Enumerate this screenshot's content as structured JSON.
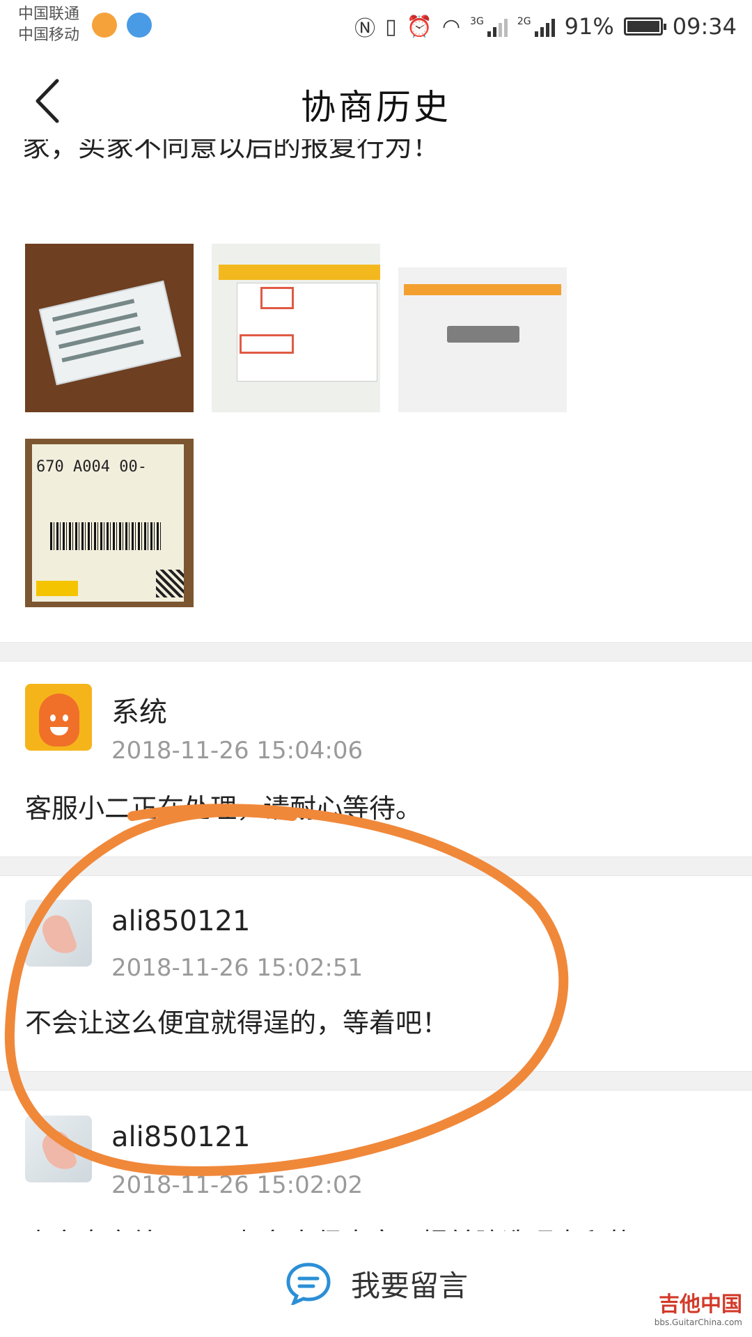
{
  "status_bar": {
    "carrier_1": "中国联通",
    "carrier_2": "中国移动",
    "net_3g": "3G",
    "net_2g": "2G",
    "battery": "91%",
    "time": "09:34"
  },
  "header": {
    "title": "协商历史"
  },
  "top_text_cut": "家，买家不同意以后的报复行为！",
  "evidence_images": [
    {
      "desc": "business-card-photo"
    },
    {
      "desc": "screenshot-with-red-marks"
    },
    {
      "desc": "app-screenshot"
    },
    {
      "desc": "shipping-label-photo",
      "label_code": "670 A004 00-"
    }
  ],
  "messages": [
    {
      "sender": "系统",
      "time": "2018-11-26 15:04:06",
      "content": "客服小二正在处理，请耐心等待。"
    },
    {
      "sender": "ali850121",
      "time": "2018-11-26 15:02:51",
      "content": "不会让这么便宜就得逞的，等着吧！"
    },
    {
      "sender": "ali850121",
      "time": "2018-11-26 15:02:02",
      "content": "卖家态度差，而且想象力很丰富，提前臆造理由和故"
    }
  ],
  "bottom": {
    "leave_message": "我要留言"
  },
  "watermark": {
    "main": "吉他中国",
    "sub": "bbs.GuitarChina.com"
  },
  "colors": {
    "annotation": "#f0883a",
    "separator": "#f1f1f1",
    "time_text": "#9a9a9a"
  }
}
